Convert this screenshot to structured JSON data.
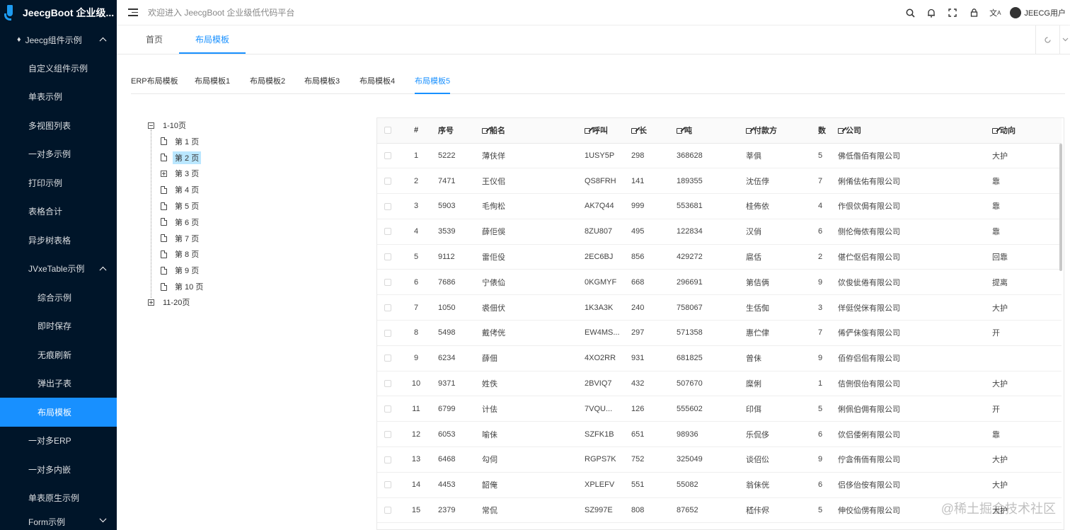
{
  "app": {
    "logo_text": "JeecgBoot 企业级...",
    "welcome": "欢迎进入 JeecgBoot 企业级低代码平台",
    "user": "JEECG用户"
  },
  "sidebar": {
    "group": "Jeecg组件示例",
    "items": [
      "自定义组件示例",
      "单表示例",
      "多视图列表",
      "一对多示例",
      "打印示例",
      "表格合计",
      "异步树表格"
    ],
    "jvxe": "JVxeTable示例",
    "jvxe_items": [
      "综合示例",
      "即时保存",
      "无痕刷新",
      "弹出子表",
      "布局模板"
    ],
    "after_items": [
      "一对多ERP",
      "一对多内嵌",
      "单表原生示例"
    ],
    "form": "Form示例"
  },
  "tabs": [
    "首页",
    "布局模板"
  ],
  "subtabs": [
    "ERP布局模板",
    "布局模板1",
    "布局模板2",
    "布局模板3",
    "布局模板4",
    "布局模板5"
  ],
  "tree": {
    "root1": "1-10页",
    "pages": [
      "第 1 页",
      "第 2 页",
      "第 3 页",
      "第 4 页",
      "第 5 页",
      "第 6 页",
      "第 7 页",
      "第 8 页",
      "第 9 页",
      "第 10 页"
    ],
    "root2": "11-20页"
  },
  "table": {
    "headers": [
      "#",
      "序号",
      "船名",
      "呼叫",
      "长",
      "吨",
      "付款方",
      "数",
      "公司",
      "动向"
    ],
    "rows": [
      [
        "1",
        "5222",
        "薄伕佯",
        "1USY5P",
        "298",
        "368628",
        "莘俱",
        "5",
        "佛低偺佰有限公司",
        "大护"
      ],
      [
        "2",
        "7471",
        "王仪佀",
        "QS8FRH",
        "141",
        "189355",
        "沈伍侼",
        "7",
        "俐倄佉佑有限公司",
        "靠"
      ],
      [
        "3",
        "5903",
        "毛侚松",
        "AK7Q44",
        "999",
        "553681",
        "桂佈依",
        "4",
        "作佷佽侷有限公司",
        "靠"
      ],
      [
        "4",
        "3539",
        "薛佢俁",
        "8ZU807",
        "495",
        "122834",
        "汉俏",
        "6",
        "侧伦侮侬有限公司",
        "靠"
      ],
      [
        "5",
        "9112",
        "雷佢伇",
        "2EC6BJ",
        "856",
        "429272",
        "扈佸",
        "2",
        "偡伫伛侣有限公司",
        "回靠"
      ],
      [
        "6",
        "7686",
        "宁俵佡",
        "0KGMYF",
        "668",
        "296691",
        "第佶俩",
        "9",
        "佽俊佌倦有限公司",
        "提离"
      ],
      [
        "7",
        "1050",
        "裘佃伏",
        "1K3A3K",
        "240",
        "758067",
        "生佸倁",
        "3",
        "佯侹侻侎有限公司",
        "大护"
      ],
      [
        "8",
        "5498",
        "戴侤侊",
        "EW4MS...",
        "297",
        "571358",
        "惠伫侓",
        "7",
        "俙俨佅侫有限公司",
        "开"
      ],
      [
        "9",
        "6234",
        "薛佃",
        "4XO2RR",
        "931",
        "681825",
        "曾佅",
        "9",
        "佰侟侣佀有限公司",
        ""
      ],
      [
        "10",
        "9371",
        "姓佚",
        "2BVIQ7",
        "432",
        "507670",
        "糜俐",
        "1",
        "佶侀佷佁有限公司",
        "大护"
      ],
      [
        "11",
        "6799",
        "计佉",
        "7VQU...",
        "126",
        "555602",
        "印佴",
        "5",
        "俐佩伯佣有限公司",
        "开"
      ],
      [
        "12",
        "6053",
        "喻佅",
        "SZFK1B",
        "651",
        "98936",
        "乐侃侈",
        "6",
        "佽侣倭俐有限公司",
        "靠"
      ],
      [
        "13",
        "6468",
        "勾伺",
        "RGPS7K",
        "752",
        "325049",
        "谈佋伀",
        "9",
        "佇侌侑侕有限公司",
        "大护"
      ],
      [
        "14",
        "4453",
        "韶俺",
        "XPLEFV",
        "551",
        "55082",
        "翁佅侊",
        "6",
        "侣侈佁侒有限公司",
        "大护"
      ],
      [
        "15",
        "2379",
        "常侃",
        "SZ997E",
        "808",
        "87652",
        "嵇佧侭",
        "5",
        "伸佼佡侽有限公司",
        "大护"
      ]
    ]
  },
  "watermark": "@稀土掘金技术社区",
  "colors": {
    "sidebar_bg": "#001529",
    "accent": "#1890ff",
    "selected_tree": "#bae7ff"
  }
}
